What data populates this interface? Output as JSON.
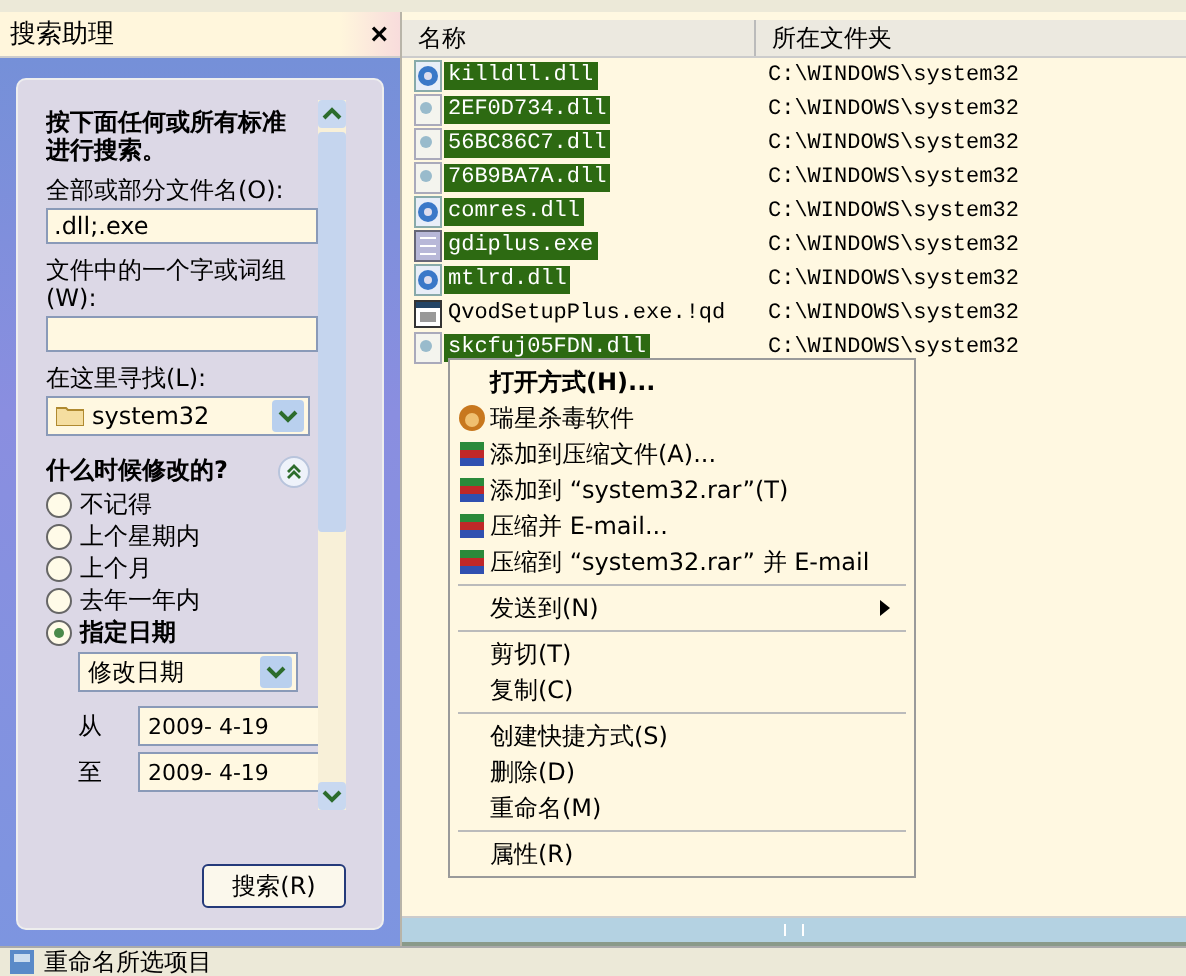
{
  "search_assistant": {
    "title": "搜索助理",
    "close": "×",
    "heading": "按下面任何或所有标准进行搜索。",
    "name_label": "全部或部分文件名(O):",
    "name_value": ".dll;.exe",
    "word_label": "文件中的一个字或词组(W):",
    "look_in_label": "在这里寻找(L):",
    "look_in_value": "system32",
    "when_heading": "什么时候修改的?",
    "when_options": [
      {
        "label": "不记得",
        "selected": false
      },
      {
        "label": "上个星期内",
        "selected": false
      },
      {
        "label": "上个月",
        "selected": false
      },
      {
        "label": "去年一年内",
        "selected": false
      },
      {
        "label": "指定日期",
        "selected": true
      }
    ],
    "date_type": "修改日期",
    "from_label": "从",
    "from_value": "2009- 4-19",
    "to_label": "至",
    "to_value": "2009- 4-19",
    "search_button": "搜索(R)"
  },
  "table": {
    "columns": [
      "名称",
      "所在文件夹"
    ],
    "rows": [
      {
        "name": "killdll.dll",
        "folder": "C:\\WINDOWS\\system32",
        "kind": "gear",
        "selected": true
      },
      {
        "name": "2EF0D734.dll",
        "folder": "C:\\WINDOWS\\system32",
        "kind": "page",
        "selected": true
      },
      {
        "name": "56BC86C7.dll",
        "folder": "C:\\WINDOWS\\system32",
        "kind": "page",
        "selected": true
      },
      {
        "name": "76B9BA7A.dll",
        "folder": "C:\\WINDOWS\\system32",
        "kind": "page",
        "selected": true
      },
      {
        "name": "comres.dll",
        "folder": "C:\\WINDOWS\\system32",
        "kind": "gear",
        "selected": true
      },
      {
        "name": "gdiplus.exe",
        "folder": "C:\\WINDOWS\\system32",
        "kind": "program",
        "selected": true
      },
      {
        "name": "mtlrd.dll",
        "folder": "C:\\WINDOWS\\system32",
        "kind": "gear",
        "selected": true
      },
      {
        "name": "QvodSetupPlus.exe.!qd",
        "folder": "C:\\WINDOWS\\system32",
        "kind": "window",
        "selected": false
      },
      {
        "name": "skcfuj05FDN.dll",
        "folder": "C:\\WINDOWS\\system32",
        "kind": "page",
        "selected": true
      }
    ]
  },
  "context_menu": [
    {
      "kind": "item",
      "label": "打开方式(H)...",
      "bold": true
    },
    {
      "kind": "antivirus",
      "label": "瑞星杀毒软件"
    },
    {
      "kind": "archiver",
      "label": "添加到压缩文件(A)..."
    },
    {
      "kind": "archiver",
      "label": "添加到 “system32.rar”(T)"
    },
    {
      "kind": "archiver",
      "label": "压缩并 E-mail..."
    },
    {
      "kind": "archiver",
      "label": "压缩到 “system32.rar” 并 E-mail"
    },
    {
      "kind": "separator"
    },
    {
      "kind": "item",
      "label": "发送到(N)",
      "submenu": true
    },
    {
      "kind": "separator"
    },
    {
      "kind": "item",
      "label": "剪切(T)"
    },
    {
      "kind": "item",
      "label": "复制(C)"
    },
    {
      "kind": "separator"
    },
    {
      "kind": "item",
      "label": "创建快捷方式(S)"
    },
    {
      "kind": "item",
      "label": "删除(D)"
    },
    {
      "kind": "item",
      "label": "重命名(M)"
    },
    {
      "kind": "separator"
    },
    {
      "kind": "item",
      "label": "属性(R)"
    }
  ],
  "status_bar": {
    "text": "重命名所选项目"
  }
}
